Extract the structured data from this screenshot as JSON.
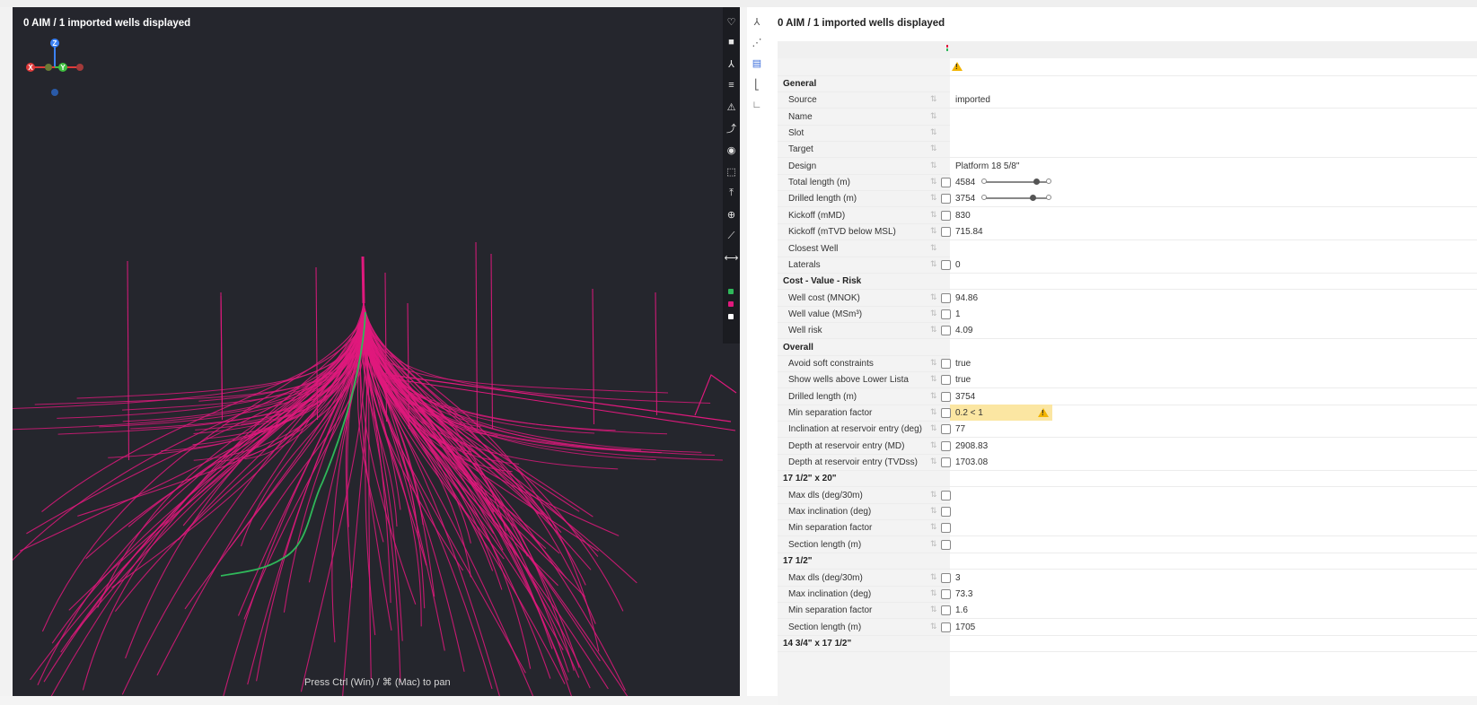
{
  "viewport": {
    "title": "0 AIM / 1 imported wells displayed",
    "hint": "Press Ctrl (Win) / ⌘ (Mac) to pan",
    "axes": {
      "z": "Z",
      "x": "X",
      "y": "Y"
    },
    "well_colors": {
      "imported": "#e0197d",
      "selected": "#2fb85a",
      "background": "#25262d"
    },
    "toolbar_icons": [
      "heart-icon",
      "camera-icon",
      "axes-icon",
      "layers-icon",
      "warning-icon",
      "trajectory-icon",
      "palette-icon",
      "select-icon",
      "upload-icon",
      "globe-icon",
      "ruler-icon",
      "measure-icon"
    ],
    "legend_colors": [
      "#2fb85a",
      "#e0197d",
      "#ffffff"
    ]
  },
  "sidebar_icons": [
    "tree-icon",
    "scatter-icon",
    "table-icon",
    "chart-icon",
    "axis-icon"
  ],
  "panel": {
    "title": "0 AIM / 1 imported wells displayed",
    "sections": [
      {
        "label": "General",
        "rows": [
          {
            "label": "Source",
            "value": "imported",
            "check": false
          },
          {
            "label": "Name",
            "value": "",
            "check": false
          },
          {
            "label": "Slot",
            "value": "",
            "check": false
          },
          {
            "label": "Target",
            "value": "",
            "check": false
          },
          {
            "label": "Design",
            "value": "Platform 18 5/8\"",
            "check": false
          },
          {
            "label": "Total length (m)",
            "value": "4584",
            "check": true,
            "slider": 0.8
          },
          {
            "label": "Drilled length (m)",
            "value": "3754",
            "check": true,
            "slider": 0.75
          },
          {
            "label": "Kickoff (mMD)",
            "value": "830",
            "check": true
          },
          {
            "label": "Kickoff (mTVD below MSL)",
            "value": "715.84",
            "check": true
          },
          {
            "label": "Closest Well",
            "value": "",
            "check": false
          },
          {
            "label": "Laterals",
            "value": "0",
            "check": true
          }
        ]
      },
      {
        "label": "Cost - Value - Risk",
        "rows": [
          {
            "label": "Well cost (MNOK)",
            "value": "94.86",
            "check": true
          },
          {
            "label": "Well value (MSm³)",
            "value": "1",
            "check": true
          },
          {
            "label": "Well risk",
            "value": "4.09",
            "check": true
          }
        ]
      },
      {
        "label": "Overall",
        "rows": [
          {
            "label": "Avoid soft constraints",
            "value": "true",
            "check": true
          },
          {
            "label": "Show wells above Lower Lista",
            "value": "true",
            "check": true
          },
          {
            "label": "Drilled length (m)",
            "value": "3754",
            "check": true
          },
          {
            "label": "Min separation factor",
            "value": "0.2 < 1",
            "check": true,
            "warning": true
          },
          {
            "label": "Inclination at reservoir entry (deg)",
            "value": "77",
            "check": true
          },
          {
            "label": "Depth at reservoir entry (MD)",
            "value": "2908.83",
            "check": true
          },
          {
            "label": "Depth at reservoir entry (TVDss)",
            "value": "1703.08",
            "check": true
          }
        ]
      },
      {
        "label": "17 1/2\" x 20\"",
        "rows": [
          {
            "label": "Max dls (deg/30m)",
            "value": "",
            "check": true
          },
          {
            "label": "Max inclination (deg)",
            "value": "",
            "check": true
          },
          {
            "label": "Min separation factor",
            "value": "",
            "check": true
          },
          {
            "label": "Section length (m)",
            "value": "",
            "check": true
          }
        ]
      },
      {
        "label": "17 1/2\"",
        "rows": [
          {
            "label": "Max dls (deg/30m)",
            "value": "3",
            "check": true
          },
          {
            "label": "Max inclination (deg)",
            "value": "73.3",
            "check": true
          },
          {
            "label": "Min separation factor",
            "value": "1.6",
            "check": true
          },
          {
            "label": "Section length (m)",
            "value": "1705",
            "check": true
          }
        ]
      },
      {
        "label": "14 3/4\" x 17 1/2\"",
        "rows": []
      }
    ]
  }
}
